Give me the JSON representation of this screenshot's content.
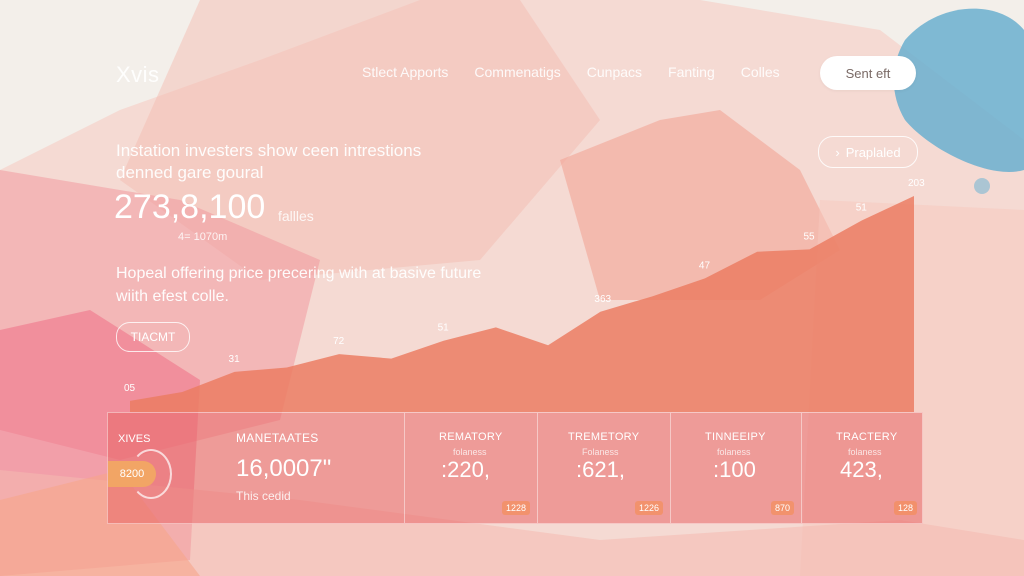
{
  "brand": {
    "logo": "Xvis"
  },
  "nav": {
    "items": [
      "Stlect Apports",
      "Commenatigs",
      "Cunpacs",
      "Fanting",
      "Colles"
    ]
  },
  "cta_label": "Sent eft",
  "pill_label": "Praplaled",
  "hero": {
    "headline": "Instation investers show ceen intrestions denned gare goural",
    "big_number": "273,8,100",
    "big_number_unit": "fallles",
    "sub_number": "4= 1070m",
    "description": "Hopeal offering price precering with at basive future wiith efest colle.",
    "button_label": "TIACMT"
  },
  "chart_data": {
    "type": "area",
    "x": [
      0,
      1,
      2,
      3,
      4,
      5,
      6,
      7,
      8,
      9,
      10,
      11,
      12,
      13,
      14,
      15
    ],
    "values": [
      5,
      9,
      18,
      20,
      26,
      24,
      32,
      38,
      30,
      45,
      52,
      60,
      72,
      73,
      86,
      97
    ],
    "point_labels": [
      {
        "index": 0,
        "text": "05"
      },
      {
        "index": 2,
        "text": "31"
      },
      {
        "index": 4,
        "text": "72"
      },
      {
        "index": 6,
        "text": "51"
      },
      {
        "index": 9,
        "text": "363"
      },
      {
        "index": 11,
        "text": "47"
      },
      {
        "index": 13,
        "text": "55"
      },
      {
        "index": 14,
        "text": "51"
      },
      {
        "index": 15,
        "text": "203"
      }
    ],
    "color": "#eb7c63"
  },
  "stats": {
    "left_label": "XIVES",
    "left_pill": "8200",
    "main": {
      "title": "MANETAATES",
      "value": "16,0007\"",
      "sub": "This cedid"
    },
    "cards": [
      {
        "title": "REMATORY",
        "sub": "folaness",
        "value": ":220,",
        "badge": "1228"
      },
      {
        "title": "TREMETORY",
        "sub": "Folaness",
        "value": ":621,",
        "badge": "1226"
      },
      {
        "title": "TINNEEIPY",
        "sub": "folaness",
        "value": ":100",
        "badge": "870"
      },
      {
        "title": "TRACTERY",
        "sub": "folaness",
        "value": "423,",
        "badge": "128"
      }
    ]
  },
  "colors": {
    "accent": "#eb7c63",
    "orange": "#f2a565",
    "blue_blob": "#5aa8c8",
    "background": "#f3efea"
  }
}
